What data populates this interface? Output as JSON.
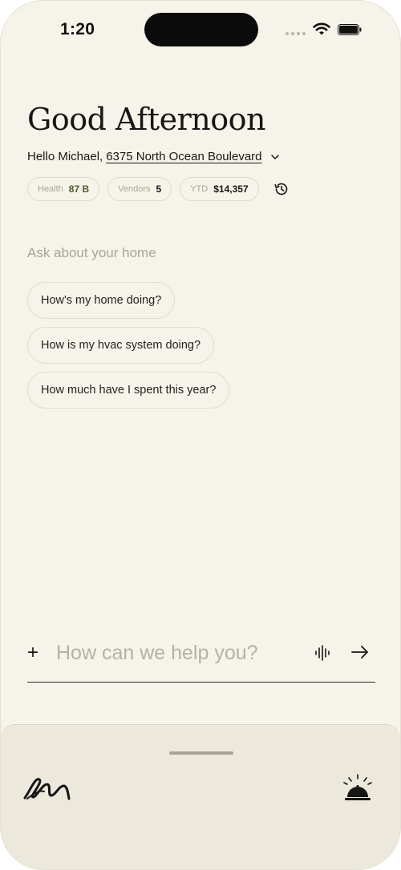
{
  "status_bar": {
    "time": "1:20"
  },
  "header": {
    "greeting": "Good Afternoon",
    "hello_text": "Hello Michael,",
    "address": "6375 North Ocean Boulevard"
  },
  "stats": [
    {
      "label": "Health",
      "value": "87 B",
      "accent": "#4d5a2a"
    },
    {
      "label": "Vendors",
      "value": "5"
    },
    {
      "label": "YTD",
      "value": "$14,357"
    }
  ],
  "ask": {
    "heading": "Ask about your home",
    "suggestions": [
      "How's my home doing?",
      "How is my hvac system doing?",
      "How much have I spent this year?"
    ]
  },
  "composer": {
    "add_label": "+",
    "placeholder": "How can we help you?",
    "value": ""
  },
  "icons": {
    "history": "history-icon",
    "chevron": "chevron-down-icon",
    "voice": "voice-wave-icon",
    "send": "arrow-right-icon",
    "logo": "brand-logo-icon",
    "bell": "concierge-bell-icon"
  },
  "colors": {
    "background": "#f6f3ea",
    "tray": "#ece9dc",
    "text": "#161616",
    "muted": "#a9a596"
  }
}
